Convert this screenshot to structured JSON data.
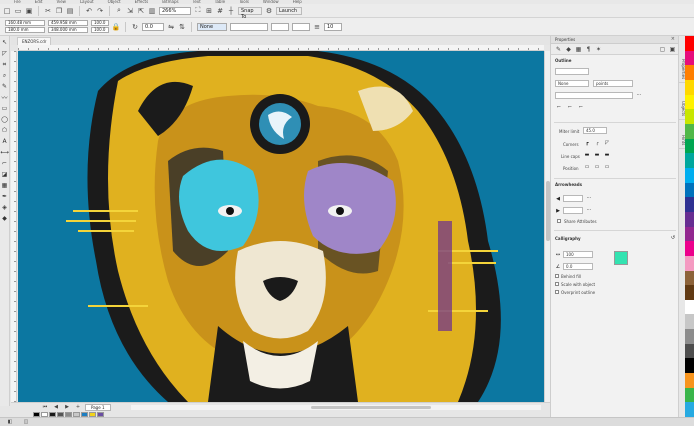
{
  "menubar": [
    "File",
    "Edit",
    "View",
    "Layout",
    "Object",
    "Effects",
    "Bitmaps",
    "Text",
    "Table",
    "Tools",
    "Window",
    "Help"
  ],
  "toolbar": {
    "zoom": "266%",
    "snap_to": "Snap To",
    "launch": "Launch"
  },
  "propbar": {
    "x": "160.48 mm",
    "y": "180.0 mm",
    "w": "459.958 mm",
    "h": "348.000 mm",
    "scale_w": "100.0",
    "scale_h": "100.0",
    "unit": "%",
    "rotation": "0.0",
    "outline": "None",
    "size": "10"
  },
  "document": {
    "tab": "ENZORS.cdr",
    "page": "Page 1"
  },
  "palette_swatches": [
    "#000000",
    "#ffffff",
    "#1a1a1a",
    "#555555",
    "#8a8a8a",
    "#c8c8c8",
    "#1c7ec2",
    "#f2d21b",
    "#6a4ea3"
  ],
  "docker": {
    "title": "Properties",
    "outline_title": "Outline",
    "outline_value": "None",
    "outline_unit": "points",
    "miter_label": "Miter limit",
    "miter_value": "45.0",
    "corners_label": "Corners",
    "line_caps_label": "Line caps",
    "position_label": "Position",
    "arrowheads_title": "Arrowheads",
    "share_attributes": "Share Attributes",
    "calligraphy_title": "Calligraphy",
    "stretch_value": "100",
    "angle_value": "0.0",
    "behind_fill": "Behind fill",
    "scale_with_object": "Scale with object",
    "overprint_outline": "Overprint outline",
    "side_tabs": [
      "Properties",
      "Objects",
      "Hints"
    ]
  },
  "colors": {
    "canvas_bg": "#0c77a1",
    "calligraphy_swatch": "#33e3b1",
    "palette": [
      "#ff0000",
      "#e60d7c",
      "#ff7f00",
      "#ffd800",
      "#fff200",
      "#c8e600",
      "#50b848",
      "#00a651",
      "#00a79d",
      "#00aeef",
      "#0072bc",
      "#2e3192",
      "#662d91",
      "#92278f",
      "#ec008c",
      "#f49ac1",
      "#8c6239",
      "#603913",
      "#ffffff",
      "#c7c7c7",
      "#8c8c8c",
      "#4d4d4d",
      "#000000",
      "#f7941d",
      "#39b54a",
      "#27aae1"
    ]
  }
}
